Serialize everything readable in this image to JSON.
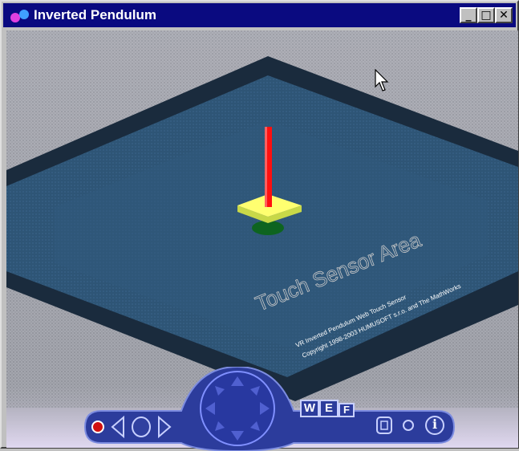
{
  "window": {
    "title": "Inverted Pendulum",
    "controls": {
      "minimize": "_",
      "maximize": "□",
      "close": "✕"
    }
  },
  "scene": {
    "floor_label": "Touch Sensor Area",
    "credits": [
      "VR Inverted Pendulum Web Touch Sensor",
      "Copyright 1998-2003 HUMUSOFT s.r.o. and The MathWorks"
    ]
  },
  "toolbar": {
    "buttons": {
      "walk": "W",
      "examine": "E",
      "fly": "F",
      "info": "i"
    }
  },
  "colors": {
    "titlebar": "#0a0a80",
    "floor": "#2f5678",
    "pole": "#ff1010",
    "cart": "#ffff60",
    "toolbar": "#2c3c9c"
  }
}
